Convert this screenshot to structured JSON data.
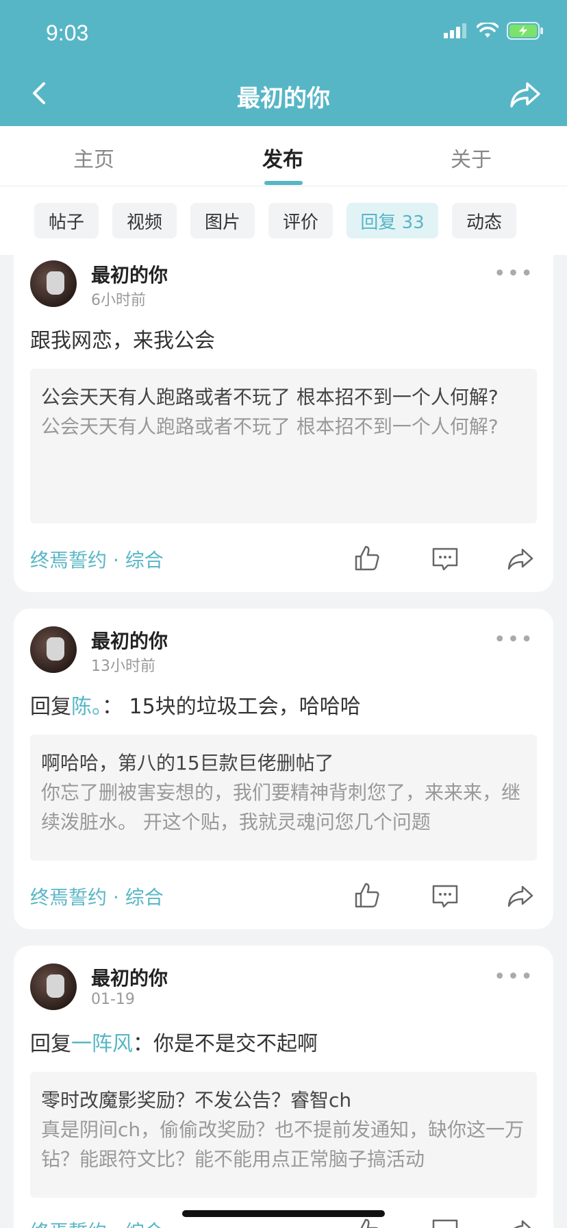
{
  "status": {
    "time": "9:03"
  },
  "nav": {
    "title": "最初的你"
  },
  "tabs": [
    {
      "label": "主页"
    },
    {
      "label": "发布"
    },
    {
      "label": "关于"
    }
  ],
  "chips": [
    {
      "label": "帖子"
    },
    {
      "label": "视频"
    },
    {
      "label": "图片"
    },
    {
      "label": "评价"
    },
    {
      "label": "回复 33"
    },
    {
      "label": "动态"
    }
  ],
  "posts": [
    {
      "author": "最初的你",
      "time": "6小时前",
      "content": "跟我网恋，来我公会",
      "quote_title": "公会天天有人跑路或者不玩了 根本招不到一个人何解?",
      "quote_body": "公会天天有人跑路或者不玩了 根本招不到一个人何解?",
      "tag": "终焉誓约 · 综合"
    },
    {
      "author": "最初的你",
      "time": "13小时前",
      "reply_prefix": "回复",
      "reply_target": "陈。",
      "reply_text": "： 15块的垃圾工会，哈哈哈",
      "quote_title": "啊哈哈，第八的15巨款巨佬删帖了",
      "quote_body": "你忘了删被害妄想的，我们要精神背刺您了，来来来，继续泼脏水。 开这个贴，我就灵魂问您几个问题",
      "tag": "终焉誓约 · 综合"
    },
    {
      "author": "最初的你",
      "time": "01-19",
      "reply_prefix": "回复",
      "reply_target": "一阵风",
      "reply_text": "：你是不是交不起啊",
      "quote_title": "零时改魔影奖励？不发公告？睿智ch",
      "quote_body": "真是阴间ch，偷偷改奖励？也不提前发通知，缺你这一万钻？能跟符文比？能不能用点正常脑子搞活动",
      "tag": "终焉誓约 · 综合"
    }
  ],
  "colors": {
    "accent": "#57b6c6",
    "header": "#57b6c6",
    "background": "#f2f3f5"
  },
  "icons": {
    "back": "chevron-left-icon",
    "share": "share-icon",
    "like": "thumb-up-icon",
    "comment": "comment-icon",
    "forward": "share-icon",
    "more": "more-dots-icon"
  }
}
